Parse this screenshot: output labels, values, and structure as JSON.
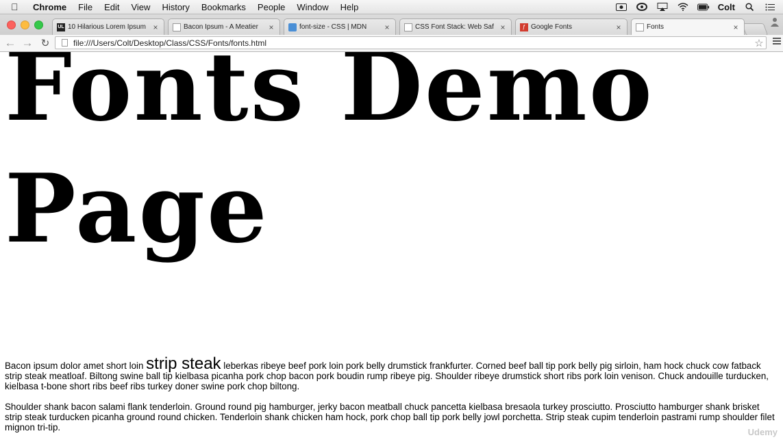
{
  "menubar": {
    "app_name": "Chrome",
    "items": [
      "File",
      "Edit",
      "View",
      "History",
      "Bookmarks",
      "People",
      "Window",
      "Help"
    ],
    "user": "Colt"
  },
  "tabs": [
    {
      "title": "10 Hilarious Lorem Ipsum",
      "favicon_text": "UL"
    },
    {
      "title": "Bacon Ipsum - A Meatier",
      "favicon_text": ""
    },
    {
      "title": "font-size - CSS | MDN",
      "favicon_text": ""
    },
    {
      "title": "CSS Font Stack: Web Saf",
      "favicon_text": ""
    },
    {
      "title": "Google Fonts",
      "favicon_text": ""
    },
    {
      "title": "Fonts",
      "favicon_text": ""
    }
  ],
  "toolbar": {
    "url": "file:///Users/Colt/Desktop/Class/CSS/Fonts/fonts.html"
  },
  "page": {
    "heading": "Fonts Demo Page",
    "para1_before": "Bacon ipsum dolor amet short loin ",
    "para1_big": "strip steak",
    "para1_after": " leberkas ribeye beef pork loin pork belly drumstick frankfurter. Corned beef ball tip pork belly pig sirloin, ham hock chuck cow fatback strip steak meatloaf. Biltong swine ball tip kielbasa picanha pork chop bacon pork boudin rump ribeye pig. Shoulder ribeye drumstick short ribs pork loin venison. Chuck andouille turducken, kielbasa t-bone short ribs beef ribs turkey doner swine pork chop biltong.",
    "para2": "Shoulder shank bacon salami flank tenderloin. Ground round pig hamburger, jerky bacon meatball chuck pancetta kielbasa bresaola turkey prosciutto. Prosciutto hamburger shank brisket strip steak turducken picanha ground round chicken. Tenderloin shank chicken ham hock, pork chop ball tip pork belly jowl porchetta. Strip steak cupim tenderloin pastrami rump shoulder filet mignon tri-tip."
  },
  "watermark": "Udemy"
}
